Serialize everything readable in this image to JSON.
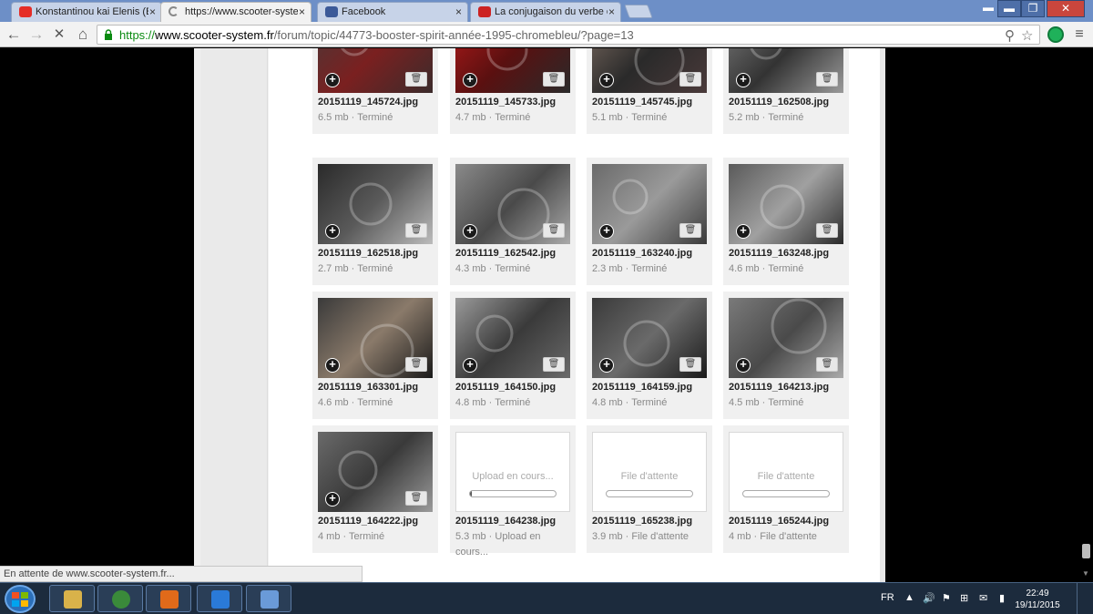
{
  "window": {
    "minimize": "▬",
    "maximize": "❐",
    "close": "✕",
    "menu": "▬"
  },
  "tabs": [
    {
      "label": "Konstantinou kai Elenis (E",
      "favicon": "youtube-icon",
      "favicon_color": "#e52d27"
    },
    {
      "label": "https://www.scooter-syste",
      "favicon": "loading-spinner-icon",
      "favicon_color": "#888888"
    },
    {
      "label": "Facebook",
      "favicon": "facebook-icon",
      "favicon_color": "#3b5998"
    },
    {
      "label": "La conjugaison du verbe é",
      "favicon": "lefigaro-icon",
      "favicon_color": "#cc2222"
    }
  ],
  "tab_close_glyph": "×",
  "nav": {
    "back": "←",
    "forward": "→",
    "stop": "✕",
    "home": "⌂",
    "zoom": "⚲",
    "star": "☆",
    "menu": "≡"
  },
  "address": {
    "scheme": "https://",
    "host": "www.scooter-system.fr",
    "path": "/forum/topic/44773-booster-spirit-année-1995-chromebleu/?page=13"
  },
  "tile_glyphs": {
    "plus": "+",
    "trash": "🗑"
  },
  "files": [
    {
      "name": "20151119_145724.jpg",
      "meta": "6.5 mb · Terminé",
      "state": "done",
      "colors": [
        "#4a3838",
        "#7a2020",
        "#3b2b2b"
      ]
    },
    {
      "name": "20151119_145733.jpg",
      "meta": "4.7 mb · Terminé",
      "state": "done",
      "colors": [
        "#b01a1a",
        "#5a1010",
        "#2a2a2a"
      ]
    },
    {
      "name": "20151119_145745.jpg",
      "meta": "5.1 mb · Terminé",
      "state": "done",
      "colors": [
        "#7a6a60",
        "#2a2a2a",
        "#4a3a3a"
      ]
    },
    {
      "name": "20151119_162508.jpg",
      "meta": "5.2 mb · Terminé",
      "state": "done",
      "colors": [
        "#777777",
        "#333333",
        "#9a9a9a"
      ]
    },
    {
      "name": "20151119_162518.jpg",
      "meta": "2.7 mb · Terminé",
      "state": "done",
      "colors": [
        "#2a2a2a",
        "#5a5a5a",
        "#bbbbbb"
      ]
    },
    {
      "name": "20151119_162542.jpg",
      "meta": "4.3 mb · Terminé",
      "state": "done",
      "colors": [
        "#8a8a8a",
        "#4a4a4a",
        "#aaaaaa"
      ]
    },
    {
      "name": "20151119_163240.jpg",
      "meta": "2.3 mb · Terminé",
      "state": "done",
      "colors": [
        "#6a6a6a",
        "#9a9a9a",
        "#3a3a3a"
      ]
    },
    {
      "name": "20151119_163248.jpg",
      "meta": "4.6 mb · Terminé",
      "state": "done",
      "colors": [
        "#5a5a5a",
        "#a0a0a0",
        "#2a2a2a"
      ]
    },
    {
      "name": "20151119_163301.jpg",
      "meta": "4.6 mb · Terminé",
      "state": "done",
      "colors": [
        "#3a3a3a",
        "#8a7a6a",
        "#1a1a1a"
      ]
    },
    {
      "name": "20151119_164150.jpg",
      "meta": "4.8 mb · Terminé",
      "state": "done",
      "colors": [
        "#9a9a9a",
        "#3a3a3a",
        "#6a6a6a"
      ]
    },
    {
      "name": "20151119_164159.jpg",
      "meta": "4.8 mb · Terminé",
      "state": "done",
      "colors": [
        "#3a3a3a",
        "#6a6a6a",
        "#1a1a1a"
      ]
    },
    {
      "name": "20151119_164213.jpg",
      "meta": "4.5 mb · Terminé",
      "state": "done",
      "colors": [
        "#7a7a7a",
        "#4a4a4a",
        "#aaaaaa"
      ]
    },
    {
      "name": "20151119_164222.jpg",
      "meta": "4 mb · Terminé",
      "state": "done",
      "colors": [
        "#6a6a6a",
        "#3a3a3a",
        "#9a9a9a"
      ]
    },
    {
      "name": "20151119_164238.jpg",
      "meta": "5.3 mb · Upload en cours...",
      "state": "uploading",
      "status": "Upload en cours...",
      "progress": 0.02
    },
    {
      "name": "20151119_165238.jpg",
      "meta": "3.9 mb · File d'attente",
      "state": "queued",
      "status": "File d'attente",
      "progress": 0
    },
    {
      "name": "20151119_165244.jpg",
      "meta": "4 mb · File d'attente",
      "state": "queued",
      "status": "File d'attente",
      "progress": 0
    }
  ],
  "statusbar": "En attente de www.scooter-system.fr...",
  "taskbar": {
    "pinned": [
      {
        "name": "file-explorer-icon",
        "color": "#d9b24a"
      },
      {
        "name": "chrome-icon",
        "color": "#3a8a3a"
      },
      {
        "name": "media-player-icon",
        "color": "#e06a1a"
      },
      {
        "name": "internet-explorer-icon",
        "color": "#2a7ad8"
      },
      {
        "name": "remote-desktop-icon",
        "color": "#6a9ad8"
      }
    ],
    "tray_lang": "FR",
    "tray_icons": [
      "▲",
      "🔊",
      "⚑",
      "⊞",
      "✉",
      "▮"
    ],
    "time": "22:49",
    "date": "19/11/2015"
  }
}
